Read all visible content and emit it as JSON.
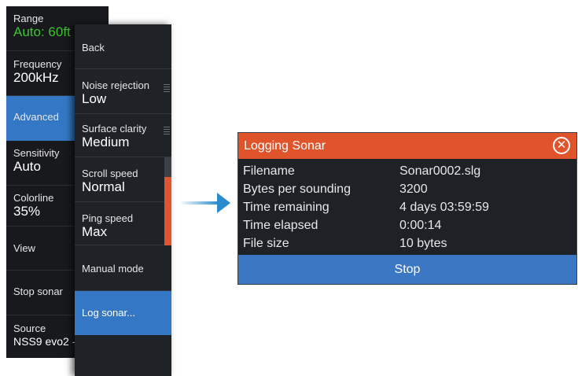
{
  "main_menu": {
    "range": {
      "label": "Range",
      "value": "Auto: 60ft"
    },
    "frequency": {
      "label": "Frequency",
      "value": "200kHz"
    },
    "advanced": {
      "label": "Advanced"
    },
    "sensitivity": {
      "label": "Sensitivity",
      "value": "Auto"
    },
    "colorline": {
      "label": "Colorline",
      "value": "35%"
    },
    "view": {
      "label": "View"
    },
    "stop_sonar": {
      "label": "Stop sonar"
    },
    "source": {
      "label": "Source",
      "value": "NSS9 evo2 - "
    }
  },
  "sub_menu": {
    "back": {
      "label": "Back"
    },
    "noise_rejection": {
      "label": "Noise rejection",
      "value": "Low"
    },
    "surface_clarity": {
      "label": "Surface clarity",
      "value": "Medium"
    },
    "scroll_speed": {
      "label": "Scroll speed",
      "value": "Normal"
    },
    "ping_speed": {
      "label": "Ping speed",
      "value": "Max"
    },
    "manual_mode": {
      "label": "Manual mode"
    },
    "log_sonar": {
      "label": "Log sonar..."
    }
  },
  "dialog": {
    "title": "Logging Sonar",
    "close_icon": "close-circle-icon",
    "rows": [
      {
        "key": "Filename",
        "value": "Sonar0002.slg"
      },
      {
        "key": "Bytes per sounding",
        "value": "3200"
      },
      {
        "key": "Time remaining",
        "value": "4 days 03:59:59"
      },
      {
        "key": "Time elapsed",
        "value": "0:00:14"
      },
      {
        "key": "File size",
        "value": "10 bytes"
      }
    ],
    "stop_label": "Stop"
  },
  "colors": {
    "accent_blue": "#3478c5",
    "header_orange": "#e0542c",
    "range_green": "#3ec234",
    "panel_dark": "#1e2125"
  }
}
